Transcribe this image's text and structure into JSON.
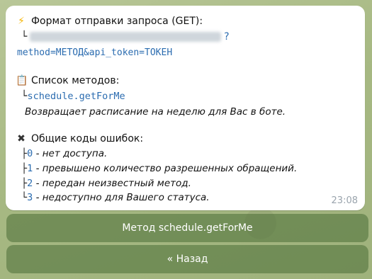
{
  "message": {
    "format_title": "Формат отправки запроса (GET):",
    "format_tree": "└",
    "format_suffix": "?",
    "format_query": "method=МЕТОД&api_token=ТОКЕН",
    "methods_title": "Список методов:",
    "method_tree": "└",
    "method_name": "schedule.getForMe",
    "method_desc": "Возвращает расписание на неделю для Вас в боте.",
    "errors_title": "Общие коды ошибок:",
    "errors": [
      {
        "tree": "├",
        "code": "0",
        "desc": " - нет доступа."
      },
      {
        "tree": "├",
        "code": "1",
        "desc": " - превышено количество разрешенных обращений."
      },
      {
        "tree": "├",
        "code": "2",
        "desc": " - передан неизвестный метод."
      },
      {
        "tree": "└",
        "code": "3",
        "desc": " - недоступно для Вашего статуса."
      }
    ],
    "time": "23:08"
  },
  "buttons": {
    "method_button": "Метод schedule.getForMe",
    "back_button": "« Назад"
  },
  "icons": {
    "lightning": "⚡",
    "clipboard": "📋",
    "cross": "✖"
  },
  "colors": {
    "code": "#2b6cb0",
    "button_bg": "#5f7c49"
  }
}
